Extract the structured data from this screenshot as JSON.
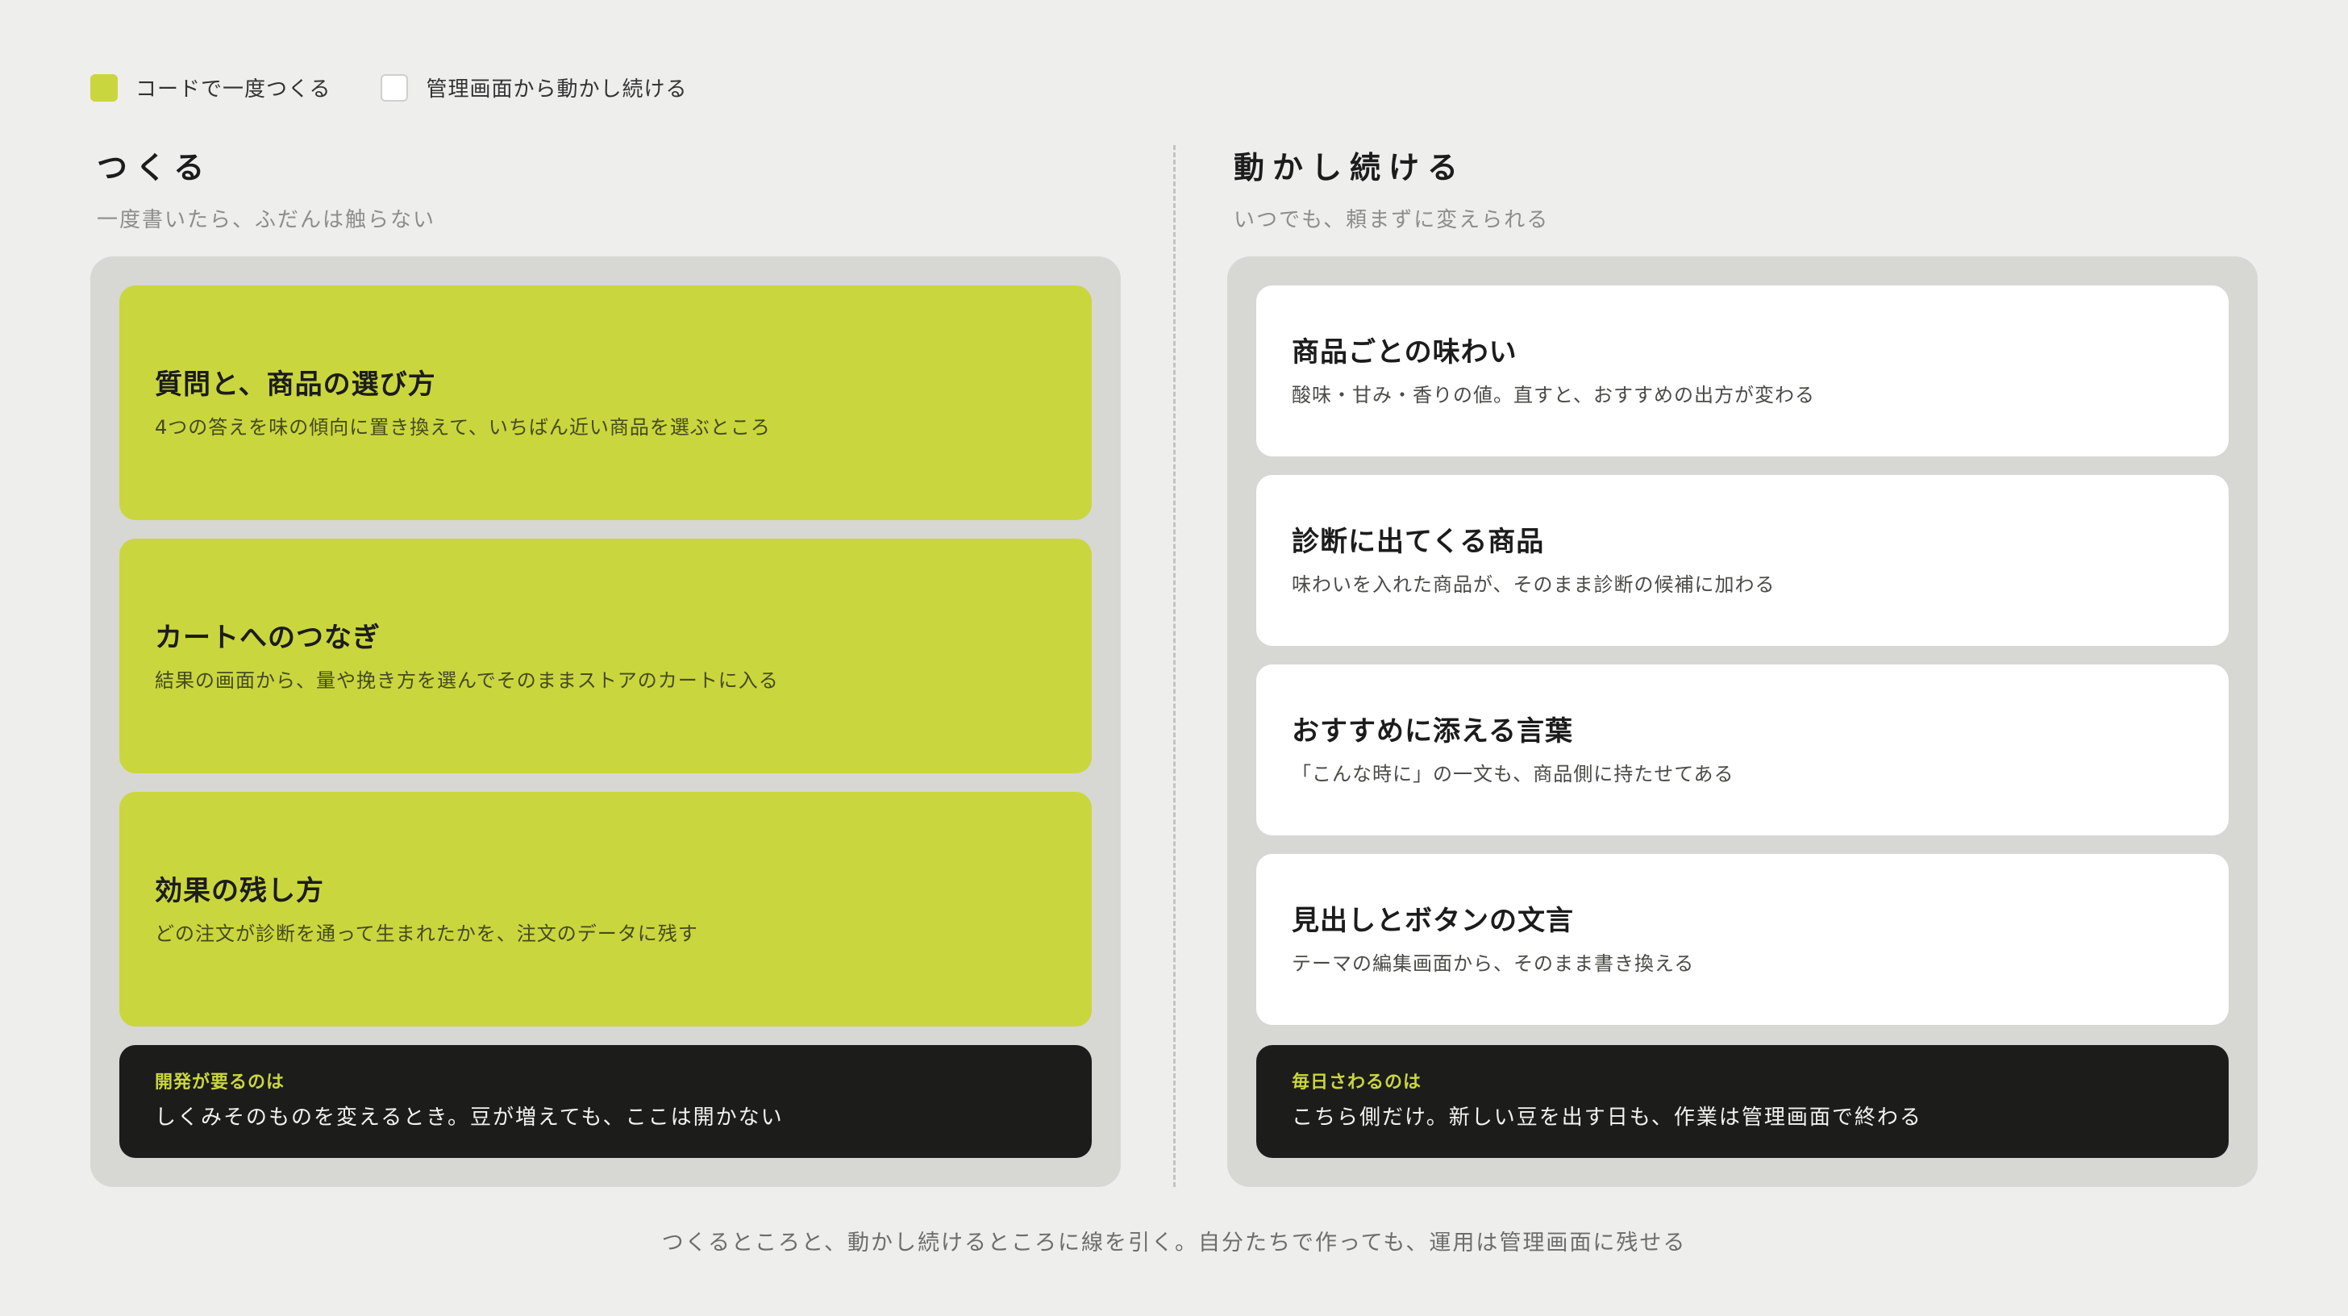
{
  "legend": [
    {
      "label": "コードで一度つくる",
      "color": "#cad63e"
    },
    {
      "label": "管理画面から動かし続ける",
      "color": "#ffffff"
    }
  ],
  "left": {
    "title": "つくる",
    "subtitle": "一度書いたら、ふだんは触らない",
    "cards": [
      {
        "title": "質問と、商品の選び方",
        "desc": "4つの答えを味の傾向に置き換えて、いちばん近い商品を選ぶところ"
      },
      {
        "title": "カートへのつなぎ",
        "desc": "結果の画面から、量や挽き方を選んでそのままストアのカートに入る"
      },
      {
        "title": "効果の残し方",
        "desc": "どの注文が診断を通って生まれたかを、注文のデータに残す"
      }
    ],
    "note": {
      "label": "開発が要るのは",
      "text": "しくみそのものを変えるとき。豆が増えても、ここは開かない"
    }
  },
  "right": {
    "title": "動かし続ける",
    "subtitle": "いつでも、頼まずに変えられる",
    "cards": [
      {
        "title": "商品ごとの味わい",
        "desc": "酸味・甘み・香りの値。直すと、おすすめの出方が変わる"
      },
      {
        "title": "診断に出てくる商品",
        "desc": "味わいを入れた商品が、そのまま診断の候補に加わる"
      },
      {
        "title": "おすすめに添える言葉",
        "desc": "「こんな時に」の一文も、商品側に持たせてある"
      },
      {
        "title": "見出しとボタンの文言",
        "desc": "テーマの編集画面から、そのまま書き換える"
      }
    ],
    "note": {
      "label": "毎日さわるのは",
      "text": "こちら側だけ。新しい豆を出す日も、作業は管理画面で終わる"
    }
  },
  "footer": "つくるところと、動かし続けるところに線を引く。自分たちで作っても、運用は管理画面に残せる",
  "colors": {
    "lime": "#cad63e",
    "dark": "#1c1c1b",
    "panel": "#d7d7d4",
    "background": "#eeeeec"
  }
}
